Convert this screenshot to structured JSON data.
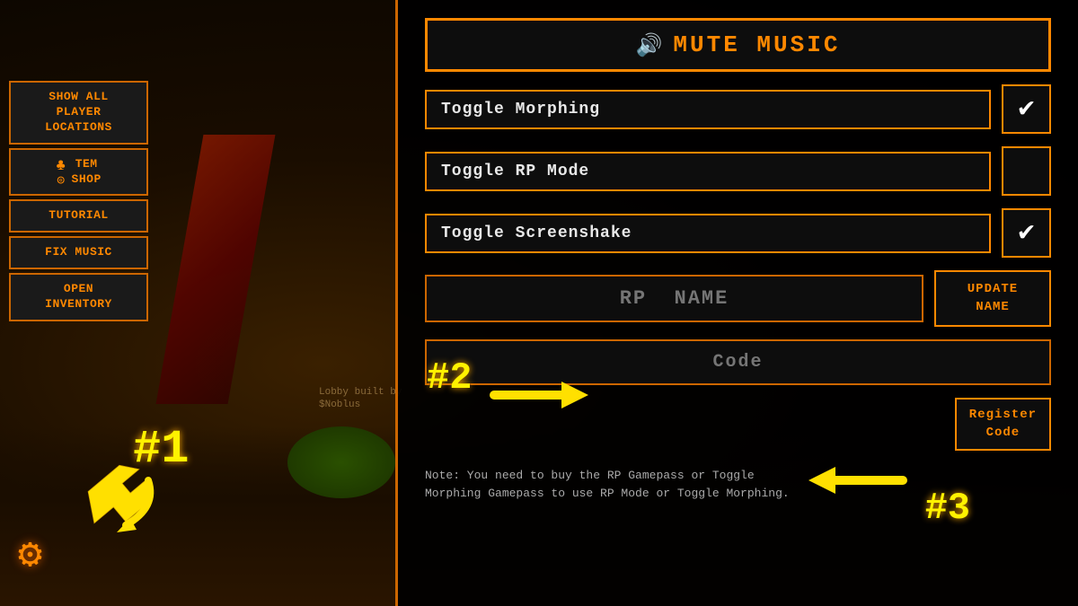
{
  "background": {
    "lobby_credit": "Lobby built by\n$Noblus"
  },
  "sidebar": {
    "buttons": [
      {
        "id": "show-all-locations",
        "label": "Show All\nPlayer\nLocations"
      },
      {
        "id": "tem-shop",
        "label": "TEM\nSHOP",
        "has_icon": true
      },
      {
        "id": "tutorial",
        "label": "Tutorial"
      },
      {
        "id": "fix-music",
        "label": "Fix Music"
      },
      {
        "id": "open-inventory",
        "label": "OPEN\nINVENTORY"
      }
    ]
  },
  "main_panel": {
    "mute_music": {
      "label": "MUTE  MUSIC",
      "icon": "🔊"
    },
    "toggle_morphing": {
      "label": "Toggle Morphing",
      "checked": true
    },
    "toggle_rp_mode": {
      "label": "Toggle RP Mode",
      "checked": false
    },
    "toggle_screenshake": {
      "label": "Toggle Screenshake",
      "checked": true
    },
    "rp_name": {
      "placeholder": "RP  NAME",
      "value": ""
    },
    "update_name_btn": "UPDATE NAME",
    "code_field": {
      "placeholder": "Code",
      "value": ""
    },
    "register_btn": "Register\nCode",
    "note": "Note:  You need to buy the RP Gamepass or Toggle\nMorphing Gamepass to use RP Mode or Toggle Morphing."
  },
  "annotations": {
    "one": "#1",
    "two": "#2",
    "three": "#3"
  },
  "gear_icon": "⚙"
}
